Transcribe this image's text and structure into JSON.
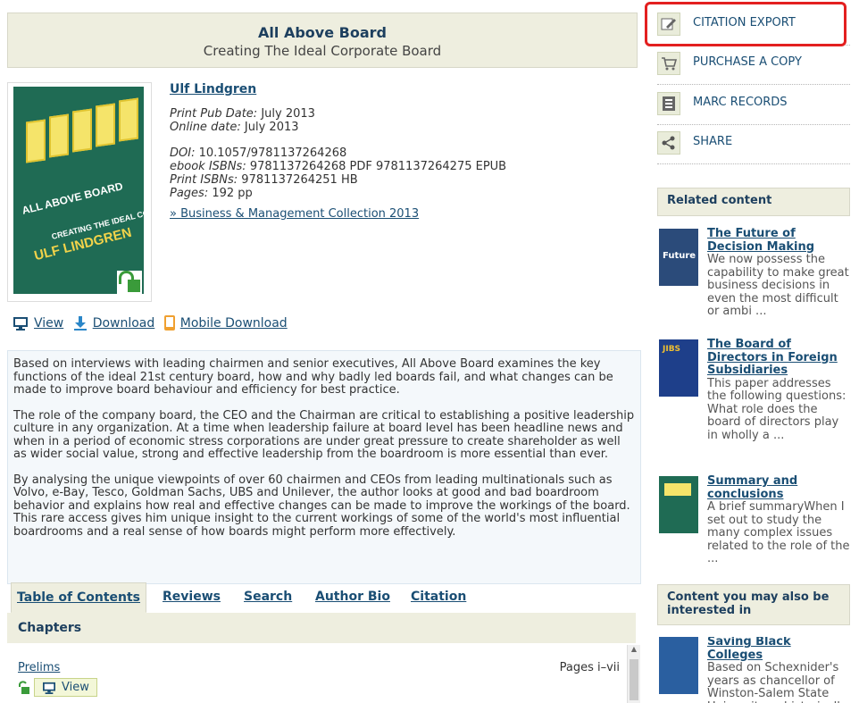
{
  "header": {
    "title": "All Above Board",
    "subtitle": "Creating The Ideal Corporate Board"
  },
  "cover": {
    "line1": "ALL ABOVE BOARD",
    "line2": "CREATING THE IDEAL CORPORATE BOARD",
    "author": "ULF LINDGREN"
  },
  "meta": {
    "author": "Ulf Lindgren",
    "print_pub_label": "Print Pub Date:",
    "print_pub_value": "July 2013",
    "online_label": "Online date:",
    "online_value": "July 2013",
    "doi_label": "DOI:",
    "doi_value": "10.1057/9781137264268",
    "ebook_label": "ebook ISBNs:",
    "ebook_value": "9781137264268 PDF 9781137264275 EPUB",
    "print_isbn_label": "Print ISBNs:",
    "print_isbn_value": "9781137264251 HB",
    "pages_label": "Pages:",
    "pages_value": "192 pp",
    "collection": "» Business & Management Collection 2013"
  },
  "actions": {
    "view": "View",
    "download": "Download",
    "mobile": "Mobile Download"
  },
  "description": [
    "Based on interviews with leading chairmen and senior executives, All Above Board examines the key functions of the ideal 21st century board, how and why badly led boards fail, and what changes can be made to improve board behaviour and efficiency for best practice.",
    "The role of the company board, the CEO and the Chairman are critical to establishing a positive leadership culture in any organization. At a time when leadership failure at board level has been headline news and when in a period of economic stress corporations are under great pressure to create shareholder as well as wider social value, strong and effective leadership from the boardroom is more essential than ever.",
    "By analysing the unique viewpoints of over 60 chairmen and CEOs from leading multinationals such as Volvo, e-Bay, Tesco, Goldman Sachs, UBS and Unilever, the author looks at good and bad boardroom behavior and explains how real and effective changes can be made to improve the workings of the board. This rare access gives him unique insight to the current workings of some of the world's most influential boardrooms and a real sense of how boards might perform more effectively."
  ],
  "tabs": [
    "Table of Contents",
    "Reviews",
    "Search",
    "Author Bio",
    "Citation"
  ],
  "chapters": {
    "heading": "Chapters",
    "first_title": "Prelims",
    "first_pages": "Pages i–vii",
    "view": "View"
  },
  "sidebar": {
    "items": [
      "CITATION EXPORT",
      "PURCHASE A COPY",
      "MARC RECORDS",
      "SHARE"
    ],
    "related_heading": "Related content",
    "related": [
      {
        "title": "The Future of Decision Making",
        "snippet": "We now possess the capability to make great business decisions in even the most difficult or ambi ..."
      },
      {
        "title": "The Board of Directors in Foreign Subsidiaries",
        "snippet": "This paper addresses the following questions: What role does the board of directors play in wholly a ..."
      },
      {
        "title": "Summary and conclusions",
        "snippet": "A brief summaryWhen I set out to study the many complex issues related to the role of the ..."
      }
    ],
    "also_heading": "Content you may also be interested in",
    "also": [
      {
        "title": "Saving Black Colleges",
        "snippet": "Based on Schexnider's years as chancellor of Winston-Salem State University, a historically"
      }
    ]
  },
  "colors": {
    "link": "#1a4e74",
    "header_bg": "#eeeedf",
    "highlight": "#e32020",
    "lock": "#3a9b3a"
  }
}
